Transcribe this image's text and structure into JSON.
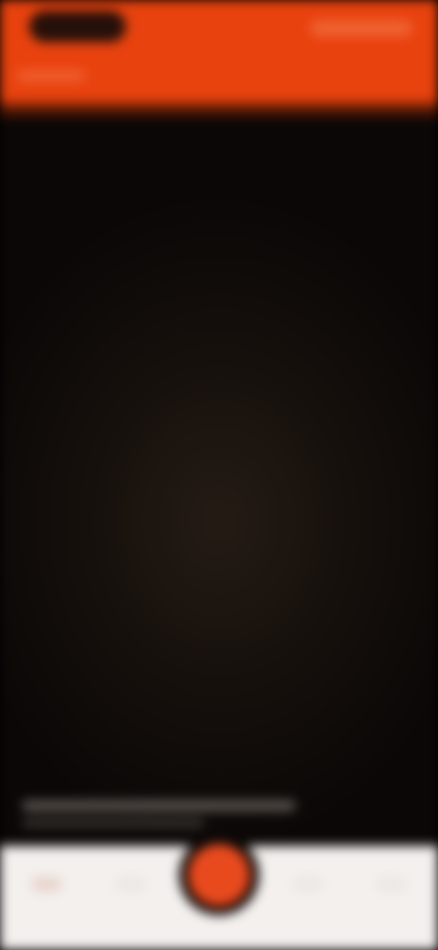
{
  "colors": {
    "header": "#e8420e",
    "background": "#080605",
    "nav_background": "#f3f0ee",
    "fab": "#e84a1e"
  },
  "icons": {
    "logo": "app-logo-icon",
    "center_action": "record-icon"
  }
}
